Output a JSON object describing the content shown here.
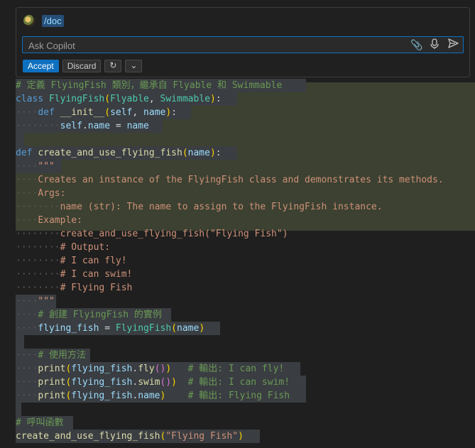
{
  "chat": {
    "command": "/doc",
    "placeholder": "Ask Copilot",
    "input_value": "",
    "icons": [
      "paperclip-icon",
      "microphone-icon",
      "send-icon"
    ],
    "accept_label": "Accept",
    "discard_label": "Discard",
    "rerun_icon": "refresh-icon",
    "more_icon": "chevron-down-icon"
  },
  "code": {
    "lines": [
      "# 定義 FlyingFish 類別，繼承自 Flyable 和 Swimmable",
      "class FlyingFish(Flyable, Swimmable):",
      "    def __init__(self, name):",
      "        self.name = name",
      "",
      "def create_and_use_flying_fish(name):",
      "    \"\"\"",
      "    Creates an instance of the FlyingFish class and demonstrates its methods.",
      "    Args:",
      "        name (str): The name to assign to the FlyingFish instance.",
      "    Example:",
      "        create_and_use_flying_fish(\"Flying Fish\")",
      "        # Output:",
      "        # I can fly!",
      "        # I can swim!",
      "        # Flying Fish",
      "    \"\"\"",
      "    # 創建 FlyingFish 的實例",
      "    flying_fish = FlyingFish(name)",
      "",
      "    # 使用方法",
      "    print(flying_fish.fly())   # 輸出: I can fly!",
      "    print(flying_fish.swim())  # 輸出: I can swim!",
      "    print(flying_fish.name)    # 輸出: Flying Fish",
      "",
      "# 呼叫函數",
      "create_and_use_flying_fish(\"Flying Fish\")"
    ]
  },
  "colors": {
    "background": "#1f1f1f",
    "selection": "#3a3d41",
    "docstring_band": "#3c4131",
    "accent": "#0e70c0"
  }
}
